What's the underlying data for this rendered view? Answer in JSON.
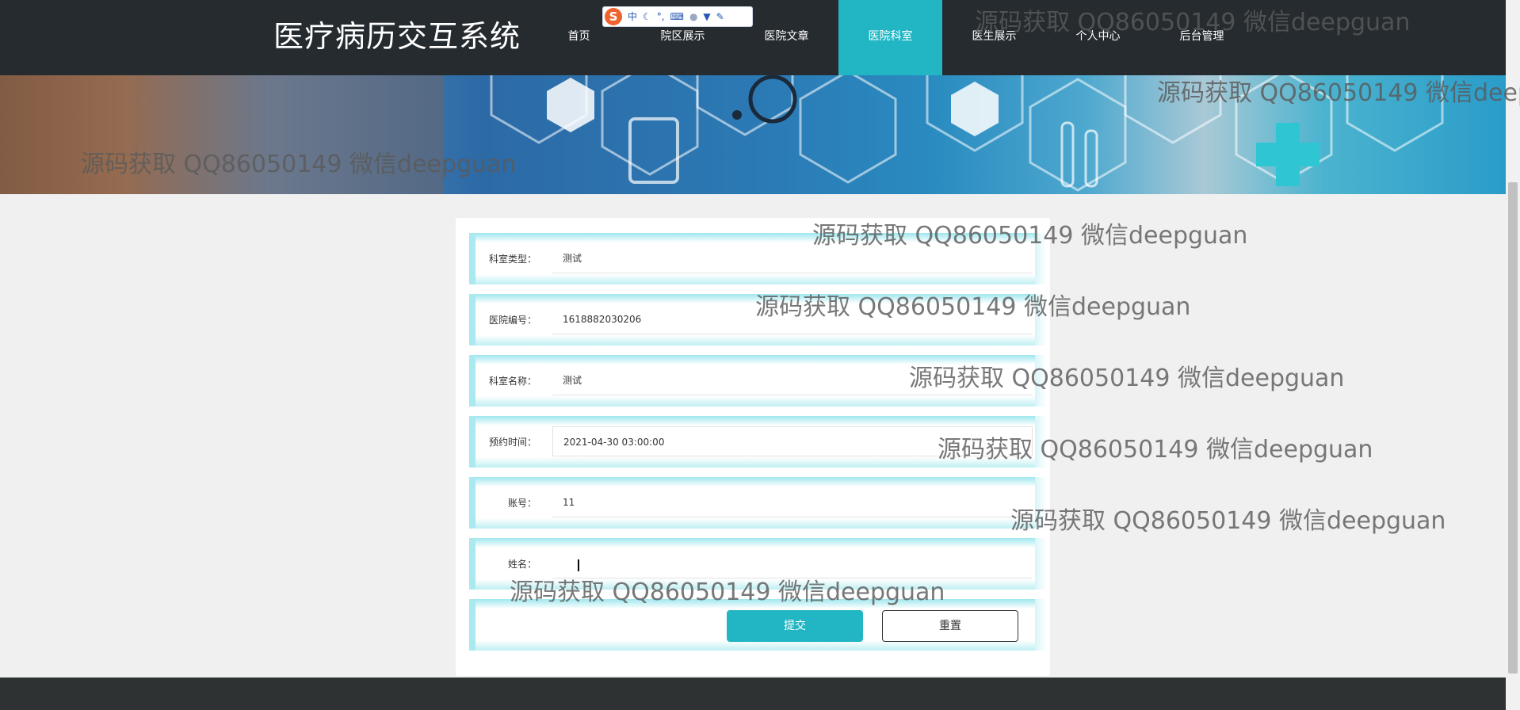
{
  "header": {
    "site_title": "医疗病历交互系统",
    "nav": [
      {
        "label": "首页",
        "active": false
      },
      {
        "label": "院区展示",
        "active": false
      },
      {
        "label": "医院文章",
        "active": false
      },
      {
        "label": "医院科室",
        "active": true
      },
      {
        "label": "医生展示",
        "active": false
      },
      {
        "label": "个人中心",
        "active": false
      },
      {
        "label": "后台管理",
        "active": false
      }
    ],
    "accent_color": "#22b6c5"
  },
  "ime_toolbar": {
    "logo": "S",
    "mode": "中",
    "icons": [
      "moon-icon",
      "punctuation-icon",
      "keyboard-icon",
      "user-icon",
      "skin-icon",
      "wrench-icon"
    ]
  },
  "form": {
    "fields": [
      {
        "label": "科室类型：",
        "value": "测试"
      },
      {
        "label": "医院编号：",
        "value": "1618882030206"
      },
      {
        "label": "科室名称：",
        "value": "测试"
      },
      {
        "label": "预约时间：",
        "value": "2021-04-30 03:00:00"
      },
      {
        "label": "账号：",
        "value": "11"
      },
      {
        "label": "姓名：",
        "value": ""
      }
    ],
    "submit_label": "提交",
    "reset_label": "重置"
  },
  "watermark": "源码获取 QQ86050149 微信deepguan"
}
